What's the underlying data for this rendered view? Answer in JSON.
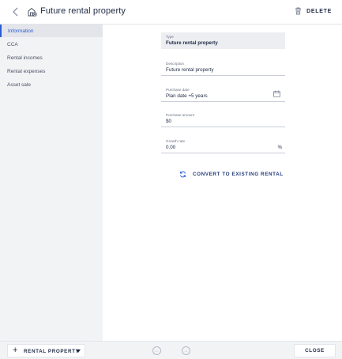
{
  "header": {
    "title": "Future rental property",
    "delete_label": "DELETE"
  },
  "sidebar": {
    "items": [
      {
        "label": "Information",
        "active": true
      },
      {
        "label": "CCA",
        "active": false
      },
      {
        "label": "Rental incomes",
        "active": false
      },
      {
        "label": "Rental expenses",
        "active": false
      },
      {
        "label": "Asset sale",
        "active": false
      }
    ]
  },
  "form": {
    "type": {
      "label": "Type",
      "value": "Future rental property"
    },
    "description": {
      "label": "Description",
      "value": "Future rental property"
    },
    "purchase_date": {
      "label": "Purchase date",
      "value": "Plan date +5 years"
    },
    "purchase_amount": {
      "label": "Purchase amount",
      "value": "$0"
    },
    "growth_rate": {
      "label": "Growth rate",
      "value": "0.00",
      "suffix": "%"
    }
  },
  "actions": {
    "convert_label": "CONVERT TO EXISTING RENTAL"
  },
  "footer": {
    "add_label": "RENTAL PROPERTY",
    "close_label": "CLOSE"
  },
  "colors": {
    "accent": "#2a5bd7",
    "sidebar_bg": "#f2f3f5",
    "text": "#1f2a44"
  }
}
